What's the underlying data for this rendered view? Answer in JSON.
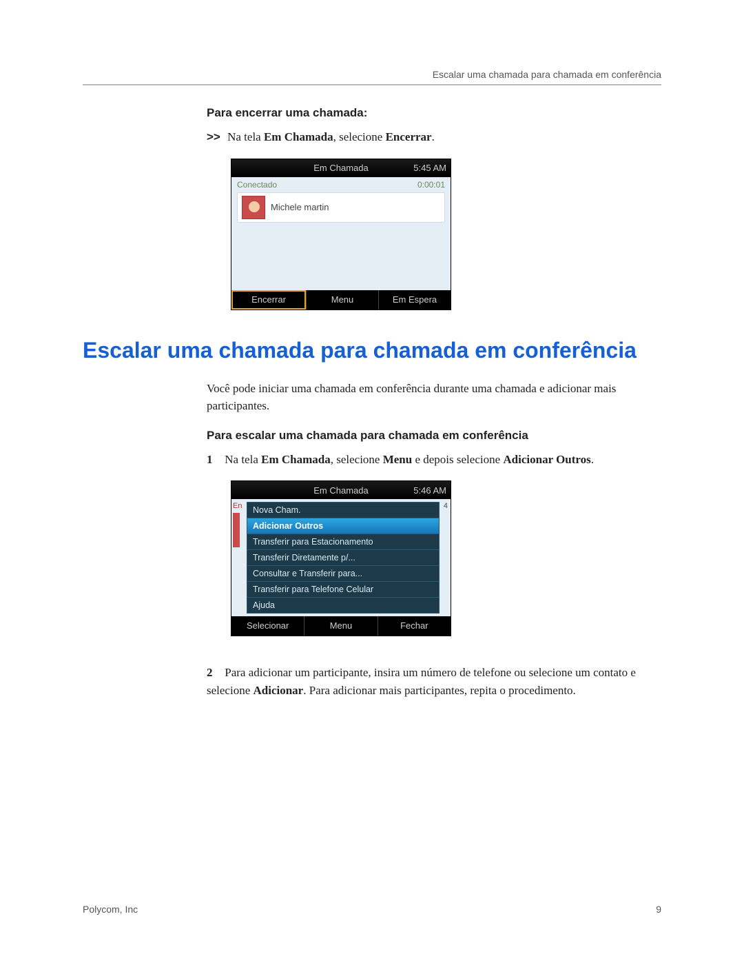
{
  "header": {
    "running_head": "Escalar uma chamada para chamada em conferência"
  },
  "section1": {
    "heading": "Para encerrar uma chamada:",
    "step_prefix": ">>",
    "step_text_1": "Na tela ",
    "step_bold_1": "Em Chamada",
    "step_text_2": ", selecione ",
    "step_bold_2": "Encerrar",
    "step_text_3": "."
  },
  "phone1": {
    "title": "Em Chamada",
    "time": "5:45 AM",
    "status": "Conectado",
    "duration": "0:00:01",
    "contact": "Michele martin",
    "softkeys": {
      "left": "Encerrar",
      "mid": "Menu",
      "right": "Em Espera"
    }
  },
  "main_heading": "Escalar uma chamada para chamada em conferência",
  "intro_para": "Você pode iniciar uma chamada em conferência durante uma chamada e adicionar mais participantes.",
  "section2": {
    "heading": "Para escalar uma chamada para chamada em conferência",
    "step1_num": "1",
    "step1_a": "Na tela ",
    "step1_b1": "Em Chamada",
    "step1_c": ", selecione ",
    "step1_b2": "Menu",
    "step1_d": " e depois selecione ",
    "step1_b3": "Adicionar Outros",
    "step1_e": ".",
    "step2_num": "2",
    "step2_a": "Para adicionar um participante, insira um número de telefone ou selecione um contato e selecione ",
    "step2_b1": "Adicionar",
    "step2_c": ". Para adicionar mais participantes, repita o procedimento."
  },
  "phone2": {
    "title": "Em Chamada",
    "time": "5:46 AM",
    "peek_left": "En",
    "peek_right": "4",
    "menu": [
      "Nova Cham.",
      "Adicionar Outros",
      "Transferir para Estacionamento",
      "Transferir Diretamente p/...",
      "Consultar e Transferir para...",
      "Transferir para Telefone Celular",
      "Ajuda"
    ],
    "selected_index": 1,
    "softkeys": {
      "left": "Selecionar",
      "mid": "Menu",
      "right": "Fechar"
    }
  },
  "footer": {
    "left": "Polycom, Inc",
    "right": "9"
  }
}
